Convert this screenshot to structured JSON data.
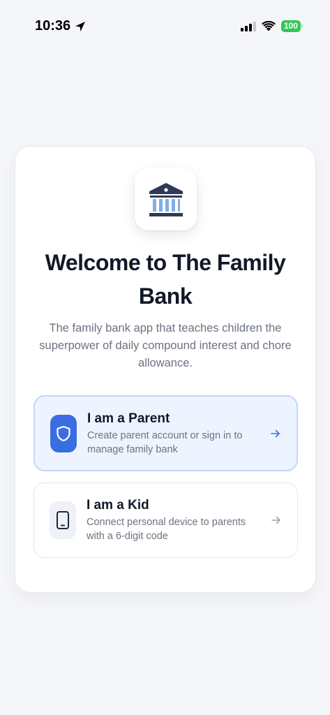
{
  "status": {
    "time": "10:36",
    "battery": "100",
    "signal_bars": 4,
    "signal_bars_active": 3,
    "colors": {
      "battery": "#34c759"
    }
  },
  "welcome": {
    "title": "Welcome to The Family Bank",
    "subtitle": "The family bank app that teaches children the superpower of daily compound interest and chore allowance.",
    "logo_icon": "bank-icon"
  },
  "roles": [
    {
      "title": "I am a Parent",
      "description": "Create parent account or sign in to manage family bank",
      "icon": "shield-icon",
      "selected": true
    },
    {
      "title": "I am a Kid",
      "description": "Connect personal device to parents with a 6-digit code",
      "icon": "phone-icon",
      "selected": false
    }
  ],
  "colors": {
    "accent": "#3b6de2",
    "logo": "#2f3a5a",
    "logo_columns": "#7fb0e6",
    "selected_bg": "#eef4ff",
    "selected_border": "#c3d6f6"
  }
}
